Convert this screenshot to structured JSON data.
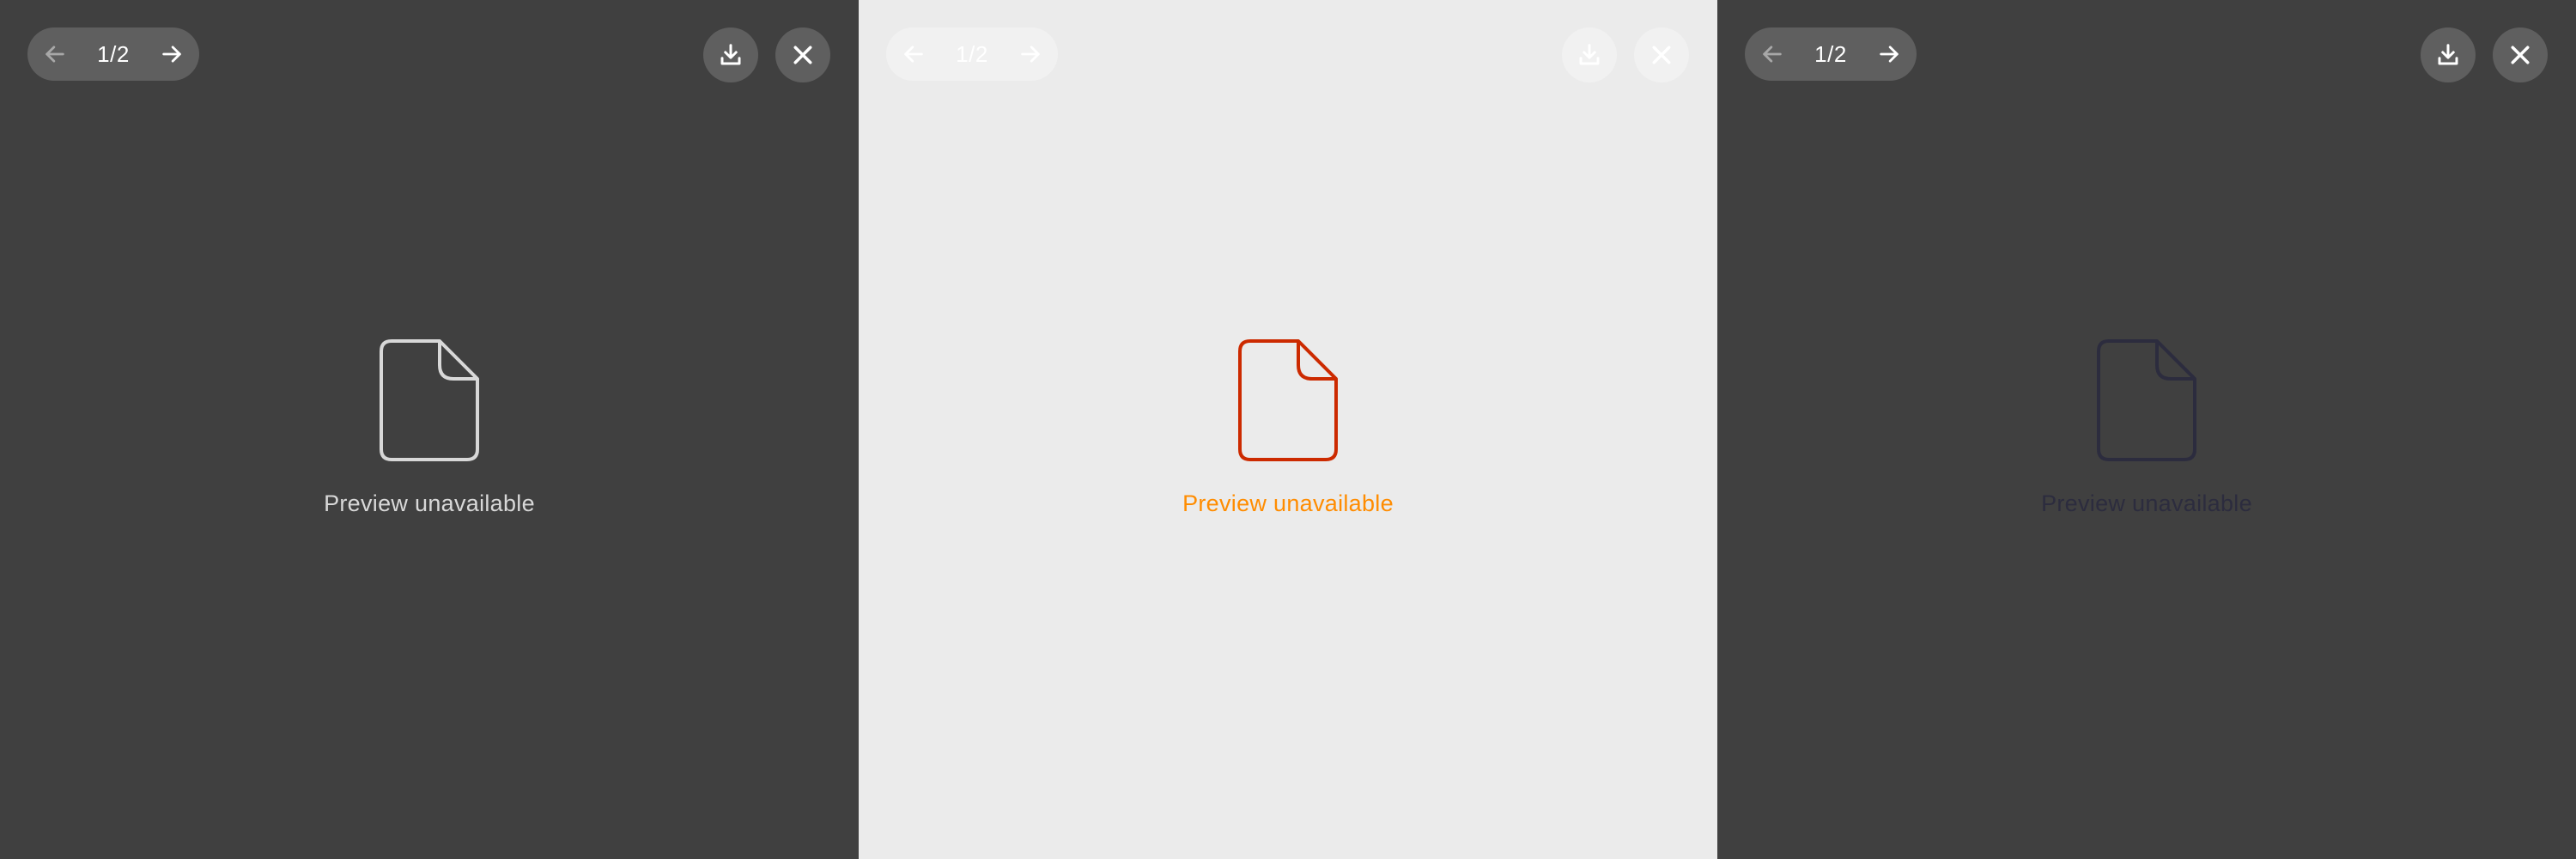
{
  "panels": [
    {
      "pager": {
        "page_count": "1/2"
      },
      "empty_state": {
        "message": "Preview unavailable"
      },
      "colors": {
        "background": "#404040",
        "icon_stroke": "#d8d8d8",
        "text": "#d8d8d8",
        "prev_arrow": "#a8a8a8",
        "next_arrow": "#ffffff",
        "action_icon": "#ffffff"
      }
    },
    {
      "pager": {
        "page_count": "1/2"
      },
      "empty_state": {
        "message": "Preview unavailable"
      },
      "colors": {
        "background": "#ebebeb",
        "icon_stroke": "#cc2a00",
        "text": "#ff8c00",
        "prev_arrow": "#ffffff",
        "next_arrow": "#ffffff",
        "action_icon": "#ffffff"
      }
    },
    {
      "pager": {
        "page_count": "1/2"
      },
      "empty_state": {
        "message": "Preview unavailable"
      },
      "colors": {
        "background": "#404040",
        "icon_stroke": "#2c2c3e",
        "text": "#2c2c3e",
        "prev_arrow": "#a8a8a8",
        "next_arrow": "#ffffff",
        "action_icon": "#ffffff"
      }
    }
  ],
  "icons": {
    "prev": "arrow-left-icon",
    "next": "arrow-right-icon",
    "download": "download-icon",
    "close": "close-icon",
    "file": "file-icon"
  }
}
